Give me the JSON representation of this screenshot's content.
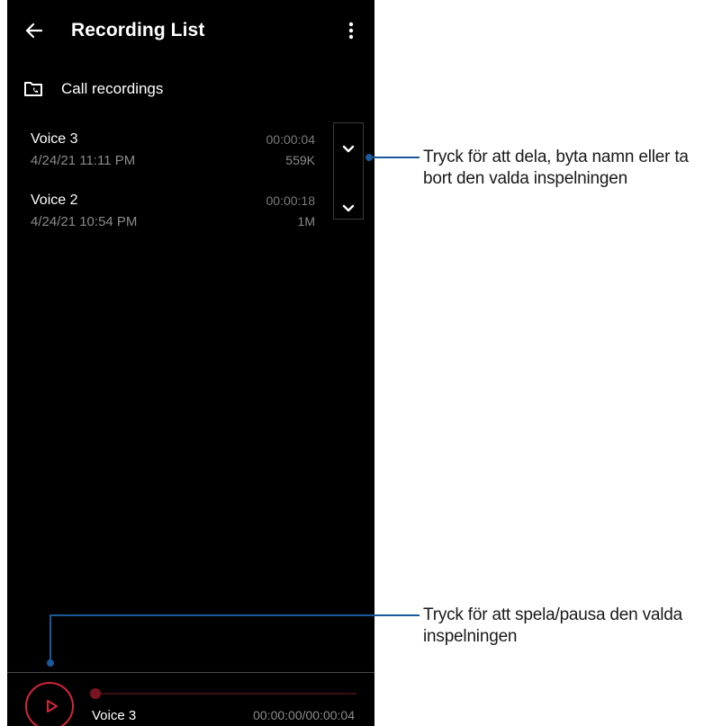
{
  "header": {
    "title": "Recording List",
    "back_icon": "arrow-left-icon",
    "menu_icon": "more-vertical-icon"
  },
  "folder": {
    "label": "Call recordings",
    "icon": "folder-phone-icon"
  },
  "recordings": [
    {
      "name": "Voice 3",
      "date": "4/24/21 11:11 PM",
      "duration": "00:00:04",
      "size": "559K"
    },
    {
      "name": "Voice 2",
      "date": "4/24/21 10:54 PM",
      "duration": "00:00:18",
      "size": "1M"
    }
  ],
  "player": {
    "name": "Voice 3",
    "time": "00:00:00/00:00:04",
    "progress": 0,
    "accent": "#d5253a"
  },
  "callouts": {
    "expand": {
      "line1": "Tryck för att dela, byta namn eller ta",
      "line2": "bort den valda inspelningen"
    },
    "play": {
      "line1": "Tryck för att spela/pausa den valda",
      "line2": "inspelningen"
    }
  },
  "colors": {
    "background": "#000000",
    "callout": "#1a5a9a",
    "text": "#ffffff"
  }
}
